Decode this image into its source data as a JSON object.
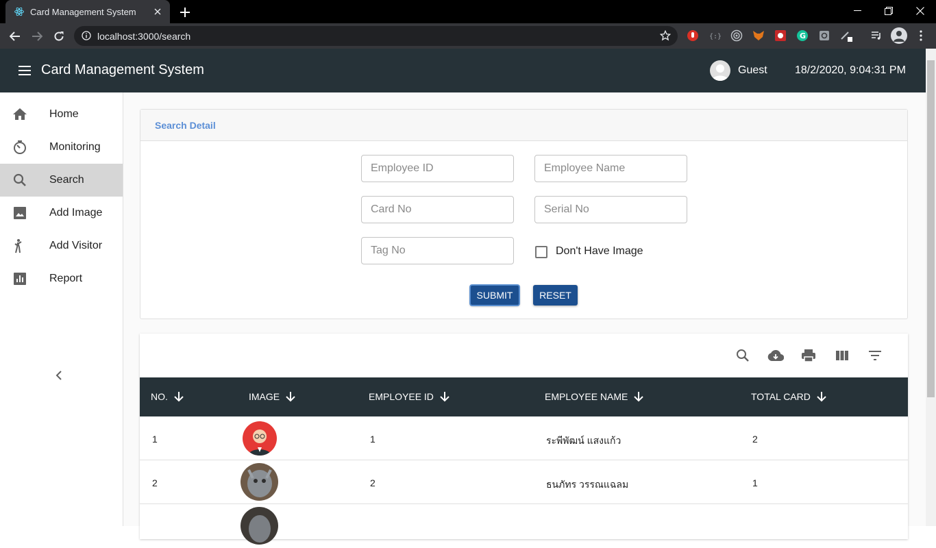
{
  "browser": {
    "tab_title": "Card Management System",
    "url": "localhost:3000/search"
  },
  "header": {
    "title": "Card Management System",
    "user": "Guest",
    "datetime": "18/2/2020, 9:04:31 PM"
  },
  "sidebar": {
    "items": [
      {
        "label": "Home",
        "icon": "home-icon"
      },
      {
        "label": "Monitoring",
        "icon": "timer-icon"
      },
      {
        "label": "Search",
        "icon": "search-icon",
        "active": true
      },
      {
        "label": "Add Image",
        "icon": "image-icon"
      },
      {
        "label": "Add Visitor",
        "icon": "walking-person-icon"
      },
      {
        "label": "Report",
        "icon": "bar-chart-icon"
      }
    ]
  },
  "search_form": {
    "title": "Search Detail",
    "employee_id_placeholder": "Employee ID",
    "employee_name_placeholder": "Employee Name",
    "card_no_placeholder": "Card No",
    "serial_no_placeholder": "Serial No",
    "tag_no_placeholder": "Tag No",
    "no_image_label": "Don't Have Image",
    "no_image_checked": false,
    "submit_label": "SUBMIT",
    "reset_label": "RESET"
  },
  "table": {
    "toolbar_icons": [
      "search-icon",
      "download-icon",
      "print-icon",
      "view-column-icon",
      "filter-icon"
    ],
    "columns": [
      "NO.",
      "IMAGE",
      "EMPLOYEE ID",
      "EMPLOYEE NAME",
      "TOTAL CARD"
    ],
    "rows": [
      {
        "no": "1",
        "employee_id": "1",
        "employee_name": "ระพีพัฒน์ แสงแก้ว",
        "total_card": "2"
      },
      {
        "no": "2",
        "employee_id": "2",
        "employee_name": "ธนภัทร วรรณแฉลม",
        "total_card": "1"
      }
    ]
  },
  "colors": {
    "appbar": "#263238",
    "button": "#1c4f8f",
    "form_title": "#5c8fd6",
    "active_nav": "#d6d6d6"
  }
}
